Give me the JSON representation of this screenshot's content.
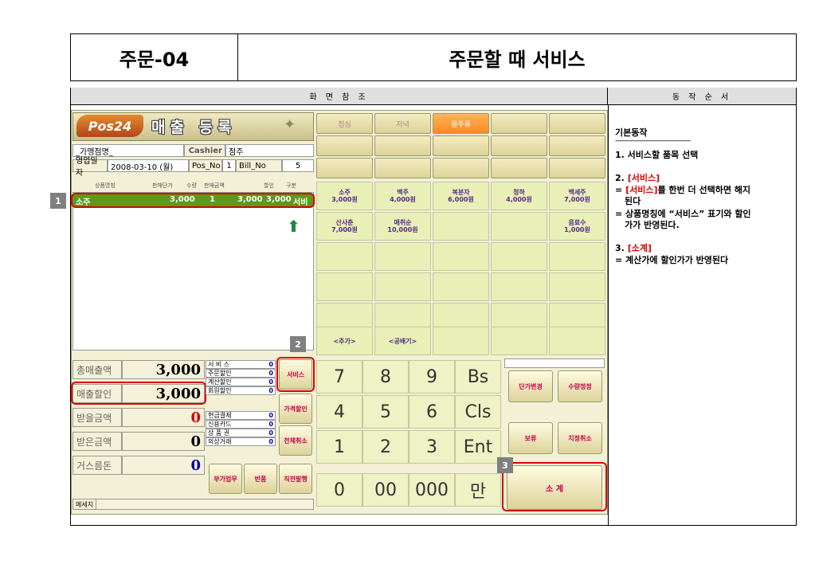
{
  "doc": {
    "code": "주문-04",
    "title": "주문할 때 서비스",
    "header_left": "화 면 참 조",
    "header_right": "동 작 순 서"
  },
  "pos": {
    "logo": "Pos24",
    "title": "매출 등록",
    "store_label": "_가맹점명_",
    "cashier_label": "Cashier",
    "cashier_value": "점주",
    "date_label": "영업일자",
    "date_value": "2008-03-10 (월)",
    "pos_no_label": "Pos_No",
    "pos_no_value": "1",
    "bill_no_label": "Bill_No",
    "bill_no_value": "5",
    "order_headers": [
      "상품명칭",
      "판매단가",
      "수량",
      "판매금액",
      "할인",
      "구분"
    ],
    "order_row": {
      "name": "소주",
      "price": "3,000",
      "qty": "1",
      "amount": "3,000",
      "discount": "3,000",
      "type": "서비"
    },
    "tabs": [
      {
        "label": "점심",
        "active": false
      },
      {
        "label": "저녁",
        "active": false
      },
      {
        "label": "음주류",
        "active": true
      },
      {
        "label": "",
        "active": false
      },
      {
        "label": "",
        "active": false
      }
    ],
    "products": [
      {
        "name": "소주",
        "price": "3,000원"
      },
      {
        "name": "맥주",
        "price": "4,000원"
      },
      {
        "name": "복분자",
        "price": "6,000원"
      },
      {
        "name": "청하",
        "price": "4,000원"
      },
      {
        "name": "백세주",
        "price": "7,000원"
      },
      {
        "name": "산사춘",
        "price": "7,000원"
      },
      {
        "name": "매취순",
        "price": "10,000원"
      },
      {
        "name": "",
        "price": ""
      },
      {
        "name": "",
        "price": ""
      },
      {
        "name": "음료수",
        "price": "1,000원"
      }
    ],
    "add_label": "<추가>",
    "blank_label": "<공배기>",
    "summary": {
      "total_sales_label": "총매출액",
      "total_sales_value": "3,000",
      "discount_label": "매출할인",
      "discount_value": "3,000",
      "receive_label": "받을금액",
      "receive_value": "0",
      "received_label": "받은금액",
      "received_value": "0",
      "change_label": "거스름돈",
      "change_value": "0"
    },
    "mini_top": [
      {
        "k": "서 비 스",
        "v": "0"
      },
      {
        "k": "주문할인",
        "v": "0"
      },
      {
        "k": "계산할인",
        "v": "0"
      },
      {
        "k": "회원할인",
        "v": "0"
      }
    ],
    "mini_bottom": [
      {
        "k": "현금결제",
        "v": "0"
      },
      {
        "k": "신용카드",
        "v": "0"
      },
      {
        "k": "상 품 권",
        "v": "0"
      },
      {
        "k": "외상거래",
        "v": "0"
      }
    ],
    "buttons": {
      "service": "서비스",
      "price_discount": "가격할인",
      "cancel_all": "전체취소",
      "extra_work": "부가업무",
      "return": "반품",
      "direct_issue": "직전발행",
      "unit_change": "단가변경",
      "qty_change": "수량정정",
      "hold": "보류",
      "designated_cancel": "지정취소",
      "subtotal": "소    계"
    },
    "keys": [
      "7",
      "8",
      "9",
      "Bs",
      "4",
      "5",
      "6",
      "Cls",
      "1",
      "2",
      "3",
      "Ent",
      "0",
      "00",
      "000",
      "만"
    ],
    "message_label": "메세지"
  },
  "badges": [
    "1",
    "2",
    "3"
  ],
  "steps": {
    "basic": "기본동작",
    "divider": "------------------------------------------",
    "s1": "1. 서비스할 품목 선택",
    "s2_num": "2.",
    "s2_tag": "[서비스]",
    "s2_eq": "=",
    "s2_line1_tag": "[서비스]",
    "s2_line1_rest": "를 한번 더 선택하면 해지",
    "s2_line2": "된다",
    "s2_line3": "= 상품명칭에 “서비스” 표기와 할인",
    "s2_line4": "가가 반영된다.",
    "s3_num": "3.",
    "s3_tag": "[소계]",
    "s3_line1": "= 계산가에 할인가가 반영된다"
  },
  "colors": {
    "accent_red": "#dd0000",
    "order_green": "#5c9a1c",
    "badge_gray": "#808080"
  }
}
